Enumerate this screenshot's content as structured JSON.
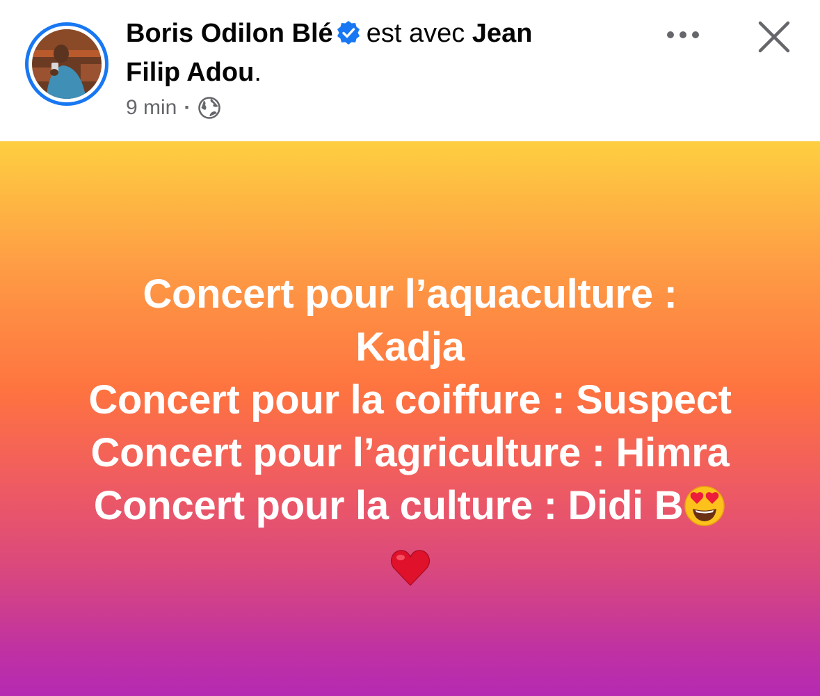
{
  "author": {
    "name": "Boris Odilon Blé",
    "connector": "est avec",
    "tagged_name_part1": "Jean",
    "tagged_name_part2": "Filip Adou",
    "period": ".",
    "verified_icon": "verified-badge-icon"
  },
  "meta": {
    "time": "9 min",
    "separator": "·",
    "audience_icon": "globe-icon"
  },
  "actions": {
    "more_icon": "ellipsis-icon",
    "close_icon": "close-icon"
  },
  "post": {
    "lines": [
      "Concert pour l’aquaculture :",
      "Kadja",
      "Concert pour la coiffure : Suspect",
      "Concert pour l’agriculture : Himra",
      "Concert pour la culture : Didi B"
    ],
    "emoji_after_last": "heart-eyes-emoji",
    "emoji_line": "red-heart-emoji"
  },
  "colors": {
    "accent": "#1877f2",
    "gradient_top": "#fecf40",
    "gradient_mid": "#fe7340",
    "gradient_bottom": "#b52ab2"
  }
}
